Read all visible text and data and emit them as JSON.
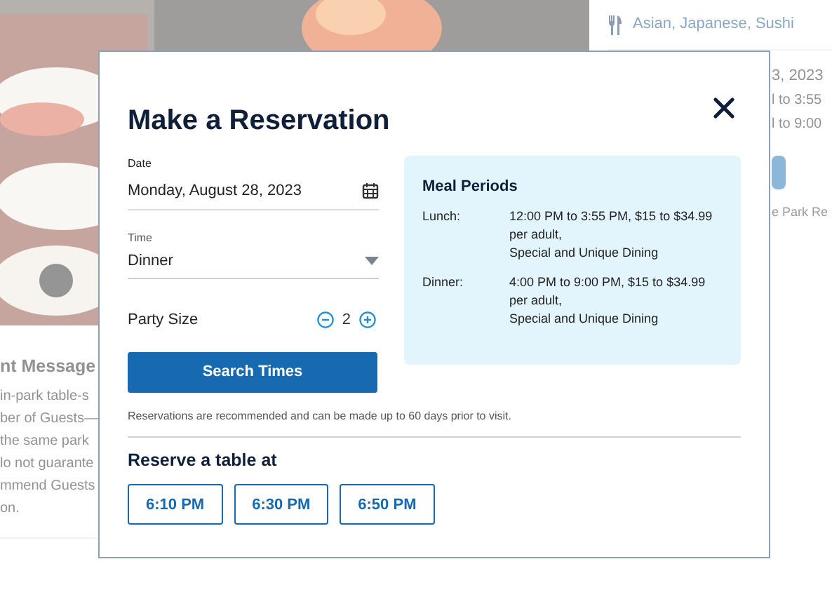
{
  "background": {
    "cuisine": "Asian, Japanese, Sushi",
    "date_fragment": "3, 2023",
    "hours_fragments": [
      "l to 3:55",
      "l to 9:00"
    ],
    "link_fragment": "e Park Re",
    "message_heading": "nt Message",
    "message_lines": [
      "in-park table-s",
      "ber of Guests—",
      "the same park",
      "lo not guarante",
      "mmend Guests",
      "on."
    ]
  },
  "dialog": {
    "title": "Make a Reservation",
    "date": {
      "label": "Date",
      "value": "Monday, August 28, 2023"
    },
    "time": {
      "label": "Time",
      "value": "Dinner"
    },
    "party": {
      "label": "Party Size",
      "value": "2"
    },
    "search_button": "Search Times",
    "note": "Reservations are recommended and can be made up to 60 days prior to visit.",
    "meal_periods": {
      "title": "Meal Periods",
      "periods": [
        {
          "name": "Lunch:",
          "lines": [
            "12:00 PM to 3:55 PM, $15 to $34.99 per adult,",
            "Special and Unique Dining"
          ]
        },
        {
          "name": "Dinner:",
          "lines": [
            "4:00 PM to 9:00 PM, $15 to $34.99 per adult,",
            "Special and Unique Dining"
          ]
        }
      ]
    },
    "reserve_heading": "Reserve a table at",
    "times": [
      "6:10 PM",
      "6:30 PM",
      "6:50 PM"
    ]
  }
}
